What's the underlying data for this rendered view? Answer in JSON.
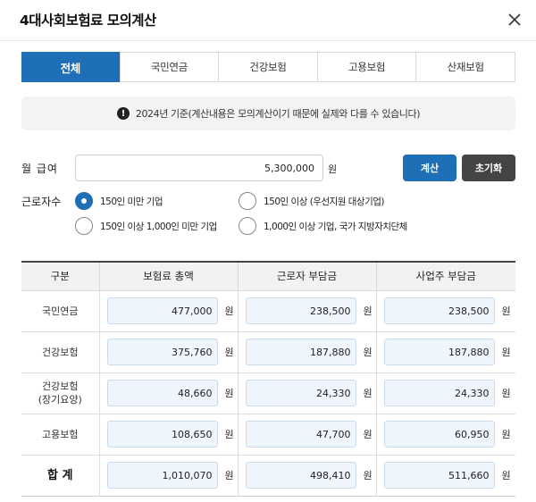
{
  "header": {
    "title": "4대사회보험료 모의계산"
  },
  "tabs": [
    {
      "label": "전체",
      "active": true
    },
    {
      "label": "국민연금",
      "active": false
    },
    {
      "label": "건강보험",
      "active": false
    },
    {
      "label": "고용보험",
      "active": false
    },
    {
      "label": "산재보험",
      "active": false
    }
  ],
  "notice": {
    "text": "2024년 기준(계산내용은 모의계산이기 때문에 실제와 다를 수 있습니다)"
  },
  "form": {
    "salary_label": "월 급여",
    "salary_value": "5,300,000",
    "salary_unit": "원",
    "calc_label": "계산",
    "reset_label": "초기화",
    "workers_label": "근로자수",
    "options": [
      {
        "label": "150인 미만 기업",
        "checked": true
      },
      {
        "label": "150인 이상 (우선지원 대상기업)",
        "checked": false
      },
      {
        "label": "150인 이상 1,000인 미만 기업",
        "checked": false
      },
      {
        "label": "1,000인 이상 기업, 국가 지방자치단체",
        "checked": false
      }
    ]
  },
  "table": {
    "headers": [
      "구분",
      "보험료 총액",
      "근로자 부담금",
      "사업주 부담금"
    ],
    "unit": "원",
    "rows": [
      {
        "label": "국민연금",
        "total": "477,000",
        "employee": "238,500",
        "employer": "238,500"
      },
      {
        "label": "건강보험",
        "total": "375,760",
        "employee": "187,880",
        "employer": "187,880"
      },
      {
        "label": "건강보험\n(장기요양)",
        "total": "48,660",
        "employee": "24,330",
        "employer": "24,330"
      },
      {
        "label": "고용보험",
        "total": "108,650",
        "employee": "47,700",
        "employer": "60,950"
      }
    ],
    "total": {
      "label": "합 계",
      "total": "1,010,070",
      "employee": "498,410",
      "employer": "511,660"
    }
  },
  "colors": {
    "accent": "#1e6fb5",
    "dark_button": "#444444",
    "value_bg": "#eef5fd"
  }
}
